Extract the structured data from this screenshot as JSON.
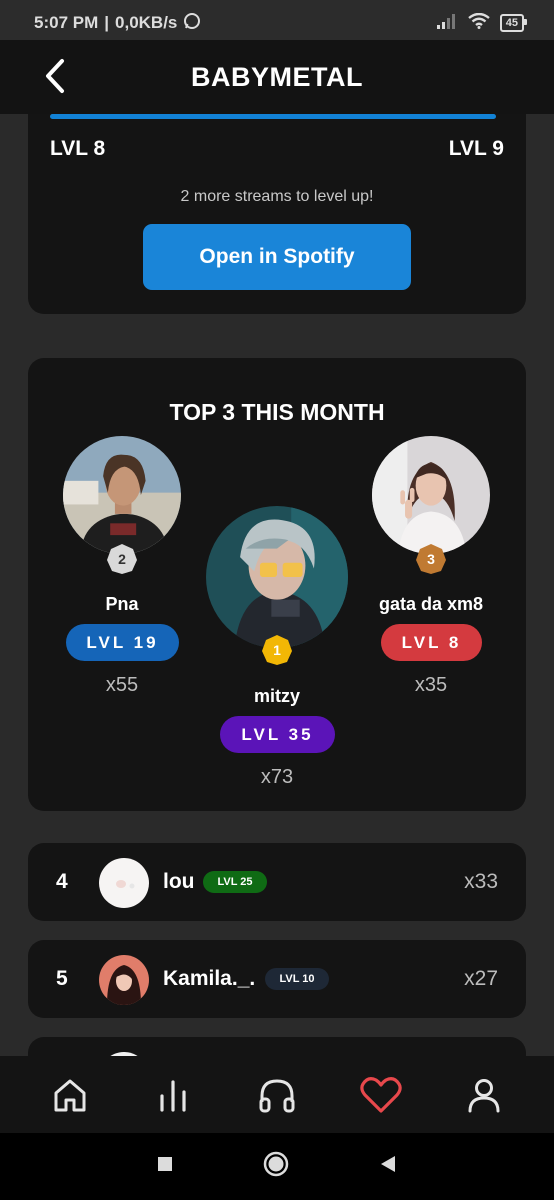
{
  "status_bar": {
    "time": "5:07 PM",
    "speed": "0,0KB/s",
    "battery": "45"
  },
  "header": {
    "title": "BABYMETAL"
  },
  "level_card": {
    "progress_percent": 100,
    "current_level": "LVL 8",
    "next_level": "LVL 9",
    "note": "2 more streams to level up!",
    "button_label": "Open in Spotify"
  },
  "top3": {
    "title": "TOP 3 THIS MONTH",
    "first": {
      "rank": "1",
      "name": "mitzy",
      "level": "LVL 35",
      "count": "x73",
      "color": "#5b14b8"
    },
    "second": {
      "rank": "2",
      "name": "Pna",
      "level": "LVL 19",
      "count": "x55",
      "color": "#1565b8"
    },
    "third": {
      "rank": "3",
      "name": "gata da xm8",
      "level": "LVL 8",
      "count": "x35",
      "color": "#d43a3f"
    }
  },
  "leaderboard": [
    {
      "rank": "4",
      "name": "lou",
      "level": "LVL 25",
      "count": "x33",
      "color": "#0f6b14"
    },
    {
      "rank": "5",
      "name": "Kamila._.",
      "level": "LVL 10",
      "count": "x27",
      "color": "#1e2836"
    }
  ],
  "nav": {
    "items": [
      "home-icon",
      "stats-icon",
      "headphones-icon",
      "heart-icon",
      "profile-icon"
    ],
    "active_color": "#e8484c"
  }
}
